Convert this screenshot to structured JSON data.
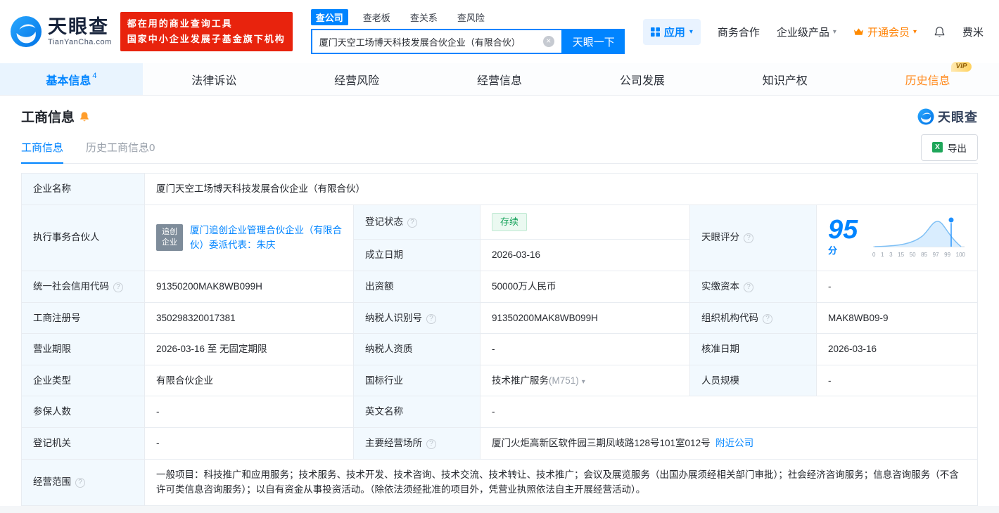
{
  "icons": {
    "help": "?",
    "caret": "▾",
    "clear": "×",
    "excel": "X"
  },
  "header": {
    "brand": "天眼查",
    "brand_domain": "TianYanCha.com",
    "promo_line1": "都在用的商业查询工具",
    "promo_line2": "国家中小企业发展子基金旗下机构",
    "search": {
      "tabs": [
        {
          "label": "查公司"
        },
        {
          "label": "查老板"
        },
        {
          "label": "查关系"
        },
        {
          "label": "查风险"
        }
      ],
      "value": "厦门天空工场博天科技发展合伙企业（有限合伙）",
      "submit": "天眼一下"
    },
    "nav": {
      "apps": "应用",
      "cooperation": "商务合作",
      "enterprise": "企业级产品",
      "vip": "开通会员",
      "user": "费米"
    }
  },
  "tabs": [
    {
      "label": "基本信息",
      "count": "4"
    },
    {
      "label": "法律诉讼"
    },
    {
      "label": "经营风险"
    },
    {
      "label": "经营信息"
    },
    {
      "label": "公司发展"
    },
    {
      "label": "知识产权"
    },
    {
      "label": "历史信息",
      "badge": "VIP"
    }
  ],
  "section": {
    "title": "工商信息",
    "watermark": "天眼查",
    "subtab_active": "工商信息",
    "subtab_history": "历史工商信息0",
    "export": "导出"
  },
  "score": {
    "value": "95",
    "unit": "分",
    "axis": [
      "0",
      "1",
      "3",
      "15",
      "50",
      "85",
      "97",
      "99",
      "100"
    ]
  },
  "fields": {
    "company_name": {
      "label": "企业名称",
      "value": "厦门天空工场博天科技发展合伙企业（有限合伙）"
    },
    "executive_partner": {
      "label": "执行事务合伙人",
      "badge_line1": "追创",
      "badge_line2": "企业",
      "link": "厦门追创企业管理合伙企业（有限合伙）委派代表：朱庆"
    },
    "registration_status": {
      "label": "登记状态",
      "value": "存续"
    },
    "tyc_score": {
      "label": "天眼评分"
    },
    "establish_date": {
      "label": "成立日期",
      "value": "2026-03-16"
    },
    "credit_code": {
      "label": "统一社会信用代码",
      "value": "91350200MAK8WB099H"
    },
    "contribution": {
      "label": "出资额",
      "value": "50000万人民币"
    },
    "paid_capital": {
      "label": "实缴资本",
      "value": "-"
    },
    "reg_number": {
      "label": "工商注册号",
      "value": "350298320017381"
    },
    "taxpayer_id": {
      "label": "纳税人识别号",
      "value": "91350200MAK8WB099H"
    },
    "org_code": {
      "label": "组织机构代码",
      "value": "MAK8WB09-9"
    },
    "business_term": {
      "label": "营业期限",
      "value": "2026-03-16 至 无固定期限"
    },
    "taxpayer_qualification": {
      "label": "纳税人资质",
      "value": "-"
    },
    "approval_date": {
      "label": "核准日期",
      "value": "2026-03-16"
    },
    "company_type": {
      "label": "企业类型",
      "value": "有限合伙企业"
    },
    "industry": {
      "label": "国标行业",
      "value": "技术推广服务",
      "code": "(M751)"
    },
    "staff_size": {
      "label": "人员规模",
      "value": "-"
    },
    "insured_count": {
      "label": "参保人数",
      "value": "-"
    },
    "english_name": {
      "label": "英文名称",
      "value": "-"
    },
    "registration_authority": {
      "label": "登记机关",
      "value": "-"
    },
    "business_address": {
      "label": "主要经营场所",
      "value": "厦门火炬高新区软件园三期凤岐路128号101室012号",
      "link": "附近公司"
    },
    "business_scope": {
      "label": "经营范围",
      "value": "一般项目：科技推广和应用服务；技术服务、技术开发、技术咨询、技术交流、技术转让、技术推广；会议及展览服务（出国办展须经相关部门审批）；社会经济咨询服务；信息咨询服务（不含许可类信息咨询服务）；以自有资金从事投资活动。（除依法须经批准的项目外，凭营业执照依法自主开展经营活动）。"
    }
  }
}
